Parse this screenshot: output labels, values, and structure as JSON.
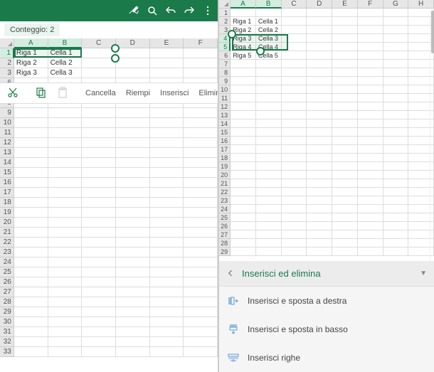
{
  "left": {
    "status": "Conteggio: 2",
    "columns": [
      "A",
      "B",
      "C",
      "D",
      "E",
      "F"
    ],
    "rows": [
      {
        "n": 1,
        "A": "Riga 1",
        "B": "Cella 1"
      },
      {
        "n": 2,
        "A": "Riga 2",
        "B": "Cella 2"
      },
      {
        "n": 3,
        "A": "Riga 3",
        "B": "Cella 3"
      }
    ],
    "total_rows": 33,
    "toolbar": {
      "cancel": "Cancella",
      "fill": "Riempi",
      "insert": "Inserisci",
      "delete": "Elimina"
    }
  },
  "right": {
    "columns": [
      "A",
      "B",
      "C",
      "D",
      "E",
      "F",
      "G",
      "H"
    ],
    "rows": [
      {
        "n": 1
      },
      {
        "n": 2,
        "A": "Riga 1",
        "B": "Cella 1"
      },
      {
        "n": 3,
        "A": "Riga 2",
        "B": "Cella 2"
      },
      {
        "n": 4,
        "A": "Riga 3",
        "B": "Cella 3"
      },
      {
        "n": 5,
        "A": "Riga 4",
        "B": "Cella 4"
      },
      {
        "n": 6,
        "A": "Riga 5",
        "B": "Cella 5"
      }
    ],
    "total_rows": 29,
    "panel": {
      "title": "Inserisci ed elimina",
      "opt1": "Inserisci e sposta a destra",
      "opt2": "Inserisci e sposta in basso",
      "opt3": "Inserisci righe"
    }
  }
}
